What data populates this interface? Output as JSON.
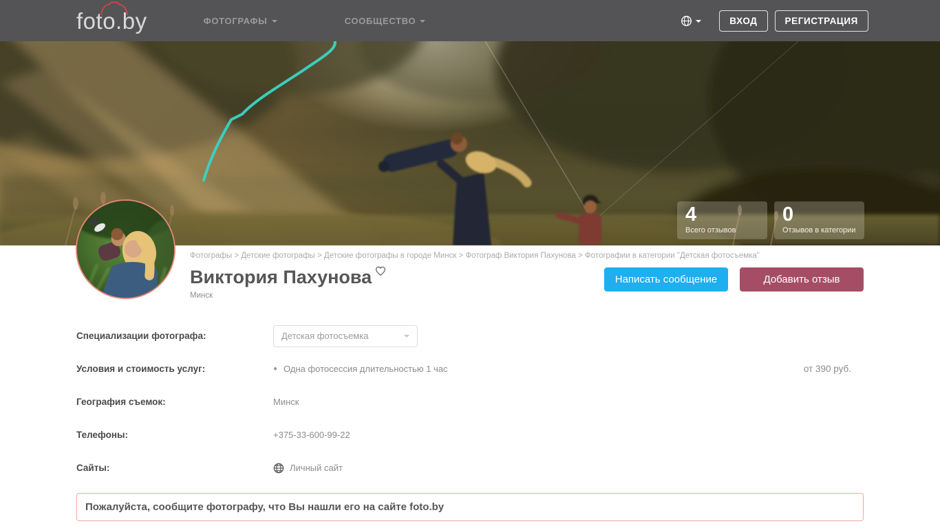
{
  "brand": {
    "name": "foto.by"
  },
  "header": {
    "nav": [
      {
        "label": "ФОТОГРАФЫ"
      },
      {
        "label": "СООБЩЕСТВО"
      }
    ],
    "login": "ВХОД",
    "register": "РЕГИСТРАЦИЯ"
  },
  "hero": {
    "stats": [
      {
        "value": "4",
        "label": "Всего отзывов"
      },
      {
        "value": "0",
        "label": "Отзывов в категории"
      }
    ]
  },
  "breadcrumb": "Фотографы > Детские фотографы > Детские фотографы в городе Минск > Фотограф Виктория Пахунова > Фотографии в категории \"Детская фотосъемка\"",
  "profile": {
    "name": "Виктория Пахунова",
    "city": "Минск",
    "actions": {
      "message": "Написать сообщение",
      "review": "Добавить отзыв"
    }
  },
  "details": {
    "specialization": {
      "label": "Специализации фотографа:",
      "selected": "Детская фотосъемка"
    },
    "pricing": {
      "label": "Условия и стоимость услуг:",
      "item": "Одна фотосессия длительностью 1 час",
      "price": "от 390 руб."
    },
    "geography": {
      "label": "География съемок:",
      "value": "Минск"
    },
    "phones": {
      "label": "Телефоны:",
      "value": "+375-33-600-99-22"
    },
    "sites": {
      "label": "Сайты:",
      "link": "Личный сайт"
    }
  },
  "notice": "Пожалуйста, сообщите фотографу, что Вы нашли его на сайте foto.by",
  "colors": {
    "header_bg": "#545456",
    "accent_blue": "#1faeef",
    "accent_maroon": "#a64d66",
    "notice_border": "#f2a6a0",
    "logo_camera_red": "#c24b41",
    "ribbon_teal": "#3bd4c5",
    "avatar_ring": "#e08576"
  }
}
